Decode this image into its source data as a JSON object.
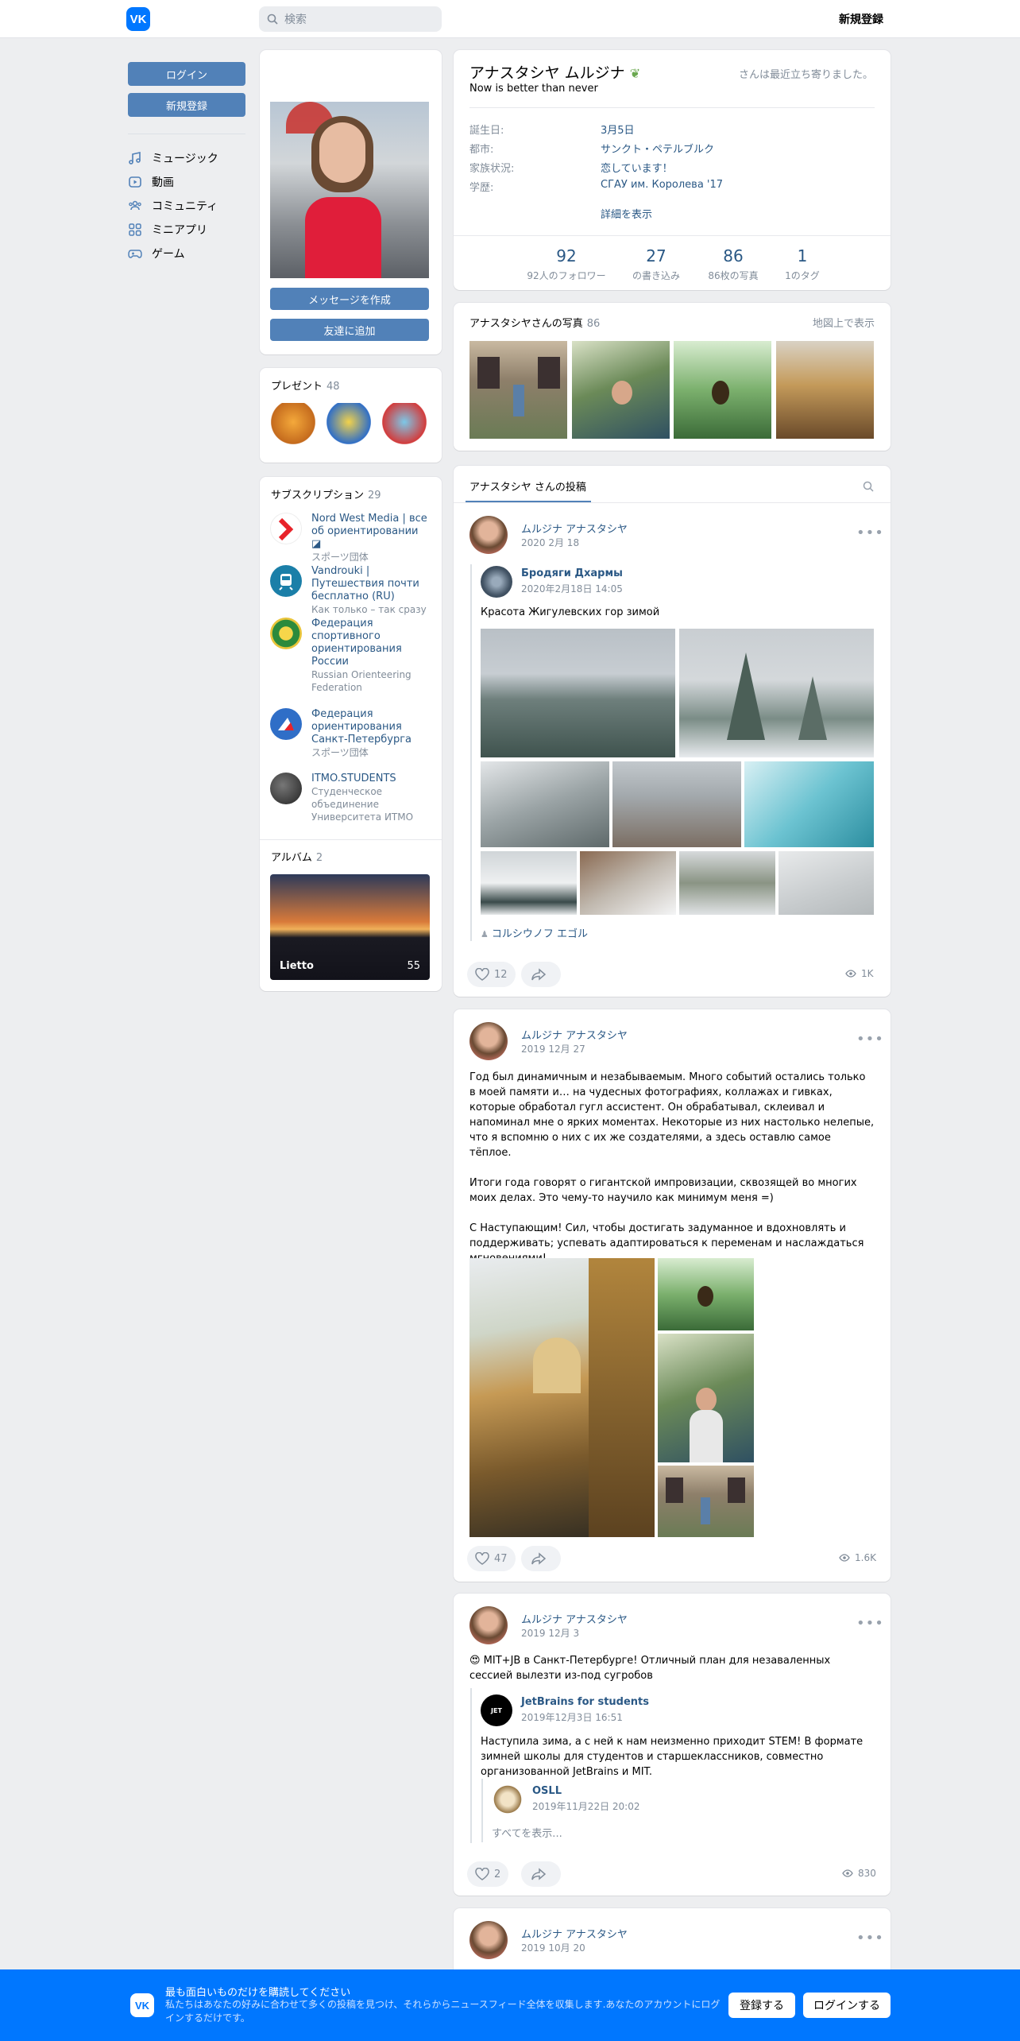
{
  "header": {
    "logo_text": "VK",
    "search_placeholder": "検索",
    "register_label": "新規登録"
  },
  "left_menu": {
    "login_label": "ログイン",
    "register_label": "新規登録",
    "items": [
      {
        "label": "ミュージック",
        "icon": "music-icon"
      },
      {
        "label": "動画",
        "icon": "video-icon"
      },
      {
        "label": "コミュニティ",
        "icon": "community-icon"
      },
      {
        "label": "ミニアプリ",
        "icon": "apps-icon"
      },
      {
        "label": "ゲーム",
        "icon": "gamepad-icon"
      }
    ]
  },
  "profile_col": {
    "message_button": "メッセージを作成",
    "add_friend_button": "友達に追加",
    "gifts": {
      "title": "プレゼント",
      "count": "48"
    },
    "subscriptions": {
      "title": "サブスクリプション",
      "count": "29",
      "items": [
        {
          "name": "Nord West Media | все об ориентировании ◪",
          "desc": "スポーツ団体"
        },
        {
          "name": "Vandrouki | Путешествия почти бесплатно (RU)",
          "desc": "Как только – так сразу"
        },
        {
          "name": "Федерация спортивного ориентирования России",
          "desc": "Russian Orienteering Federation"
        },
        {
          "name": "Федерация ориентирования Санкт-Петербурга",
          "desc": "スポーツ団体"
        },
        {
          "name": "ITMO.STUDENTS",
          "desc": "Студенческое объединение Университета ИТМО"
        }
      ]
    },
    "albums": {
      "title": "アルバム",
      "count": "2",
      "album_name": "Lietto",
      "album_count": "55"
    }
  },
  "profile": {
    "name": "アナスタシヤ ムルジナ",
    "status": "Now is better than never",
    "last_seen": "さんは最近立ち寄りました。",
    "info": [
      {
        "label": "誕生日:",
        "value": "3月5日"
      },
      {
        "label": "都市:",
        "value": "サンクト・ペテルブルク"
      },
      {
        "label": "家族状況:",
        "value": "恋しています！"
      },
      {
        "label": "学歴:",
        "value": "СГАУ им. Королева '17"
      }
    ],
    "show_more": "詳細を表示",
    "counters": [
      {
        "num": "92",
        "label": "92人のフォロワー"
      },
      {
        "num": "27",
        "label": "の書き込み"
      },
      {
        "num": "86",
        "label": "86枚の写真"
      },
      {
        "num": "1",
        "label": "1のタグ"
      }
    ]
  },
  "photos": {
    "title": "アナスタシヤさんの写真",
    "count": "86",
    "map_link": "地図上で表示"
  },
  "wall": {
    "tab_label": "アナスタシヤ さんの投稿"
  },
  "posts": [
    {
      "author": "ムルジナ アナスタシヤ",
      "date": "2020 2月 18",
      "repost_author": "Бродяги Дхармы",
      "repost_date": "2020年2月18日 14:05",
      "text": "Красота Жигулевских гор зимой",
      "signer": "コルシウノフ エゴル",
      "likes": "12",
      "views": "1K"
    },
    {
      "author": "ムルジナ アナスタシヤ",
      "date": "2019 12月 27",
      "text": "Год был динамичным и незабываемым. Много событий остались только в моей памяти и… на чудесных фотографиях, коллажах и гивках, которые обработал гугл ассистент. Он обрабатывал, склеивал и напоминал мне о ярких моментах. Некоторые из них настолько нелепые, что я вспомню о них с их же создателями, а здесь оставлю самое тёплое.\n\nИтоги года говорят о гигантской импровизации, сквозящей во многих моих делах. Это чему-то научило как минимум меня =)\n\nС Наступающим! Сил, чтобы достигать задуманное и вдохновлять и поддерживать; успевать адаптироваться к переменам и наслаждаться мгновениями!",
      "likes": "47",
      "views": "1.6K"
    },
    {
      "author": "ムルジナ アナスタシヤ",
      "date": "2019 12月 3",
      "text": "😍 MIT+JB в Санкт-Петербурге! Отличный план для незаваленных сессией вылезти из-под сугробов",
      "repost_author": "JetBrains for students",
      "repost_date": "2019年12月3日 16:51",
      "repost_text": "Наступила зима, а с ней к нам неизменно приходит STEM! В формате зимней школы для студентов и старшеклассников, совместно организованной JetBrains и MIT.",
      "inner_author": "OSLL",
      "inner_date": "2019年11月22日 20:02",
      "show_all": "すべてを表示...",
      "likes": "2",
      "views": "830"
    },
    {
      "author": "ムルジナ アナスタシヤ",
      "date": "2019 10月 20"
    }
  ],
  "banner": {
    "title": "最も面白いものだけを購読してください",
    "text": "私たちはあなたの好みに合わせて多くの投稿を見つけ、それらからニュースフィード全体を収集します.あなたのアカウントにログインするだけです。",
    "register_button": "登録する",
    "login_button": "ログインする"
  }
}
